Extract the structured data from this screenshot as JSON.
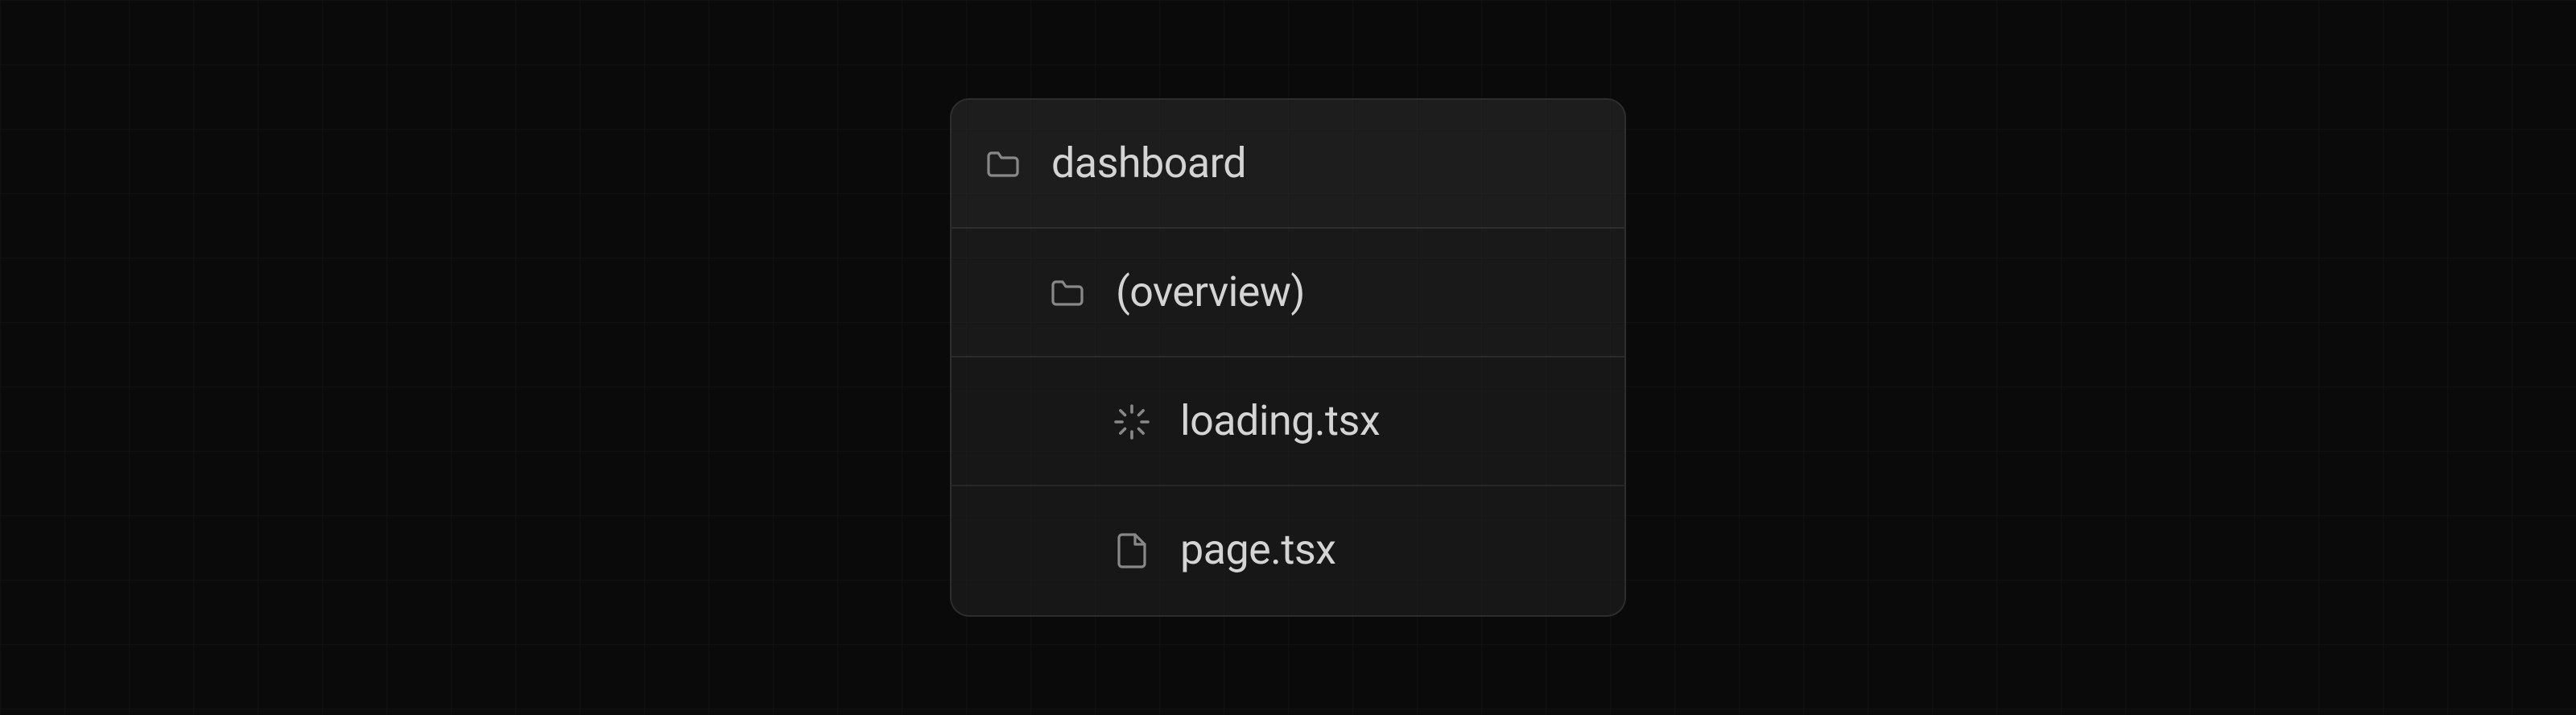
{
  "tree": {
    "rows": [
      {
        "label": "dashboard",
        "icon": "folder",
        "depth": 0
      },
      {
        "label": "(overview)",
        "icon": "folder",
        "depth": 1
      },
      {
        "label": "loading.tsx",
        "icon": "spinner",
        "depth": 2
      },
      {
        "label": "page.tsx",
        "icon": "file",
        "depth": 2
      }
    ]
  }
}
